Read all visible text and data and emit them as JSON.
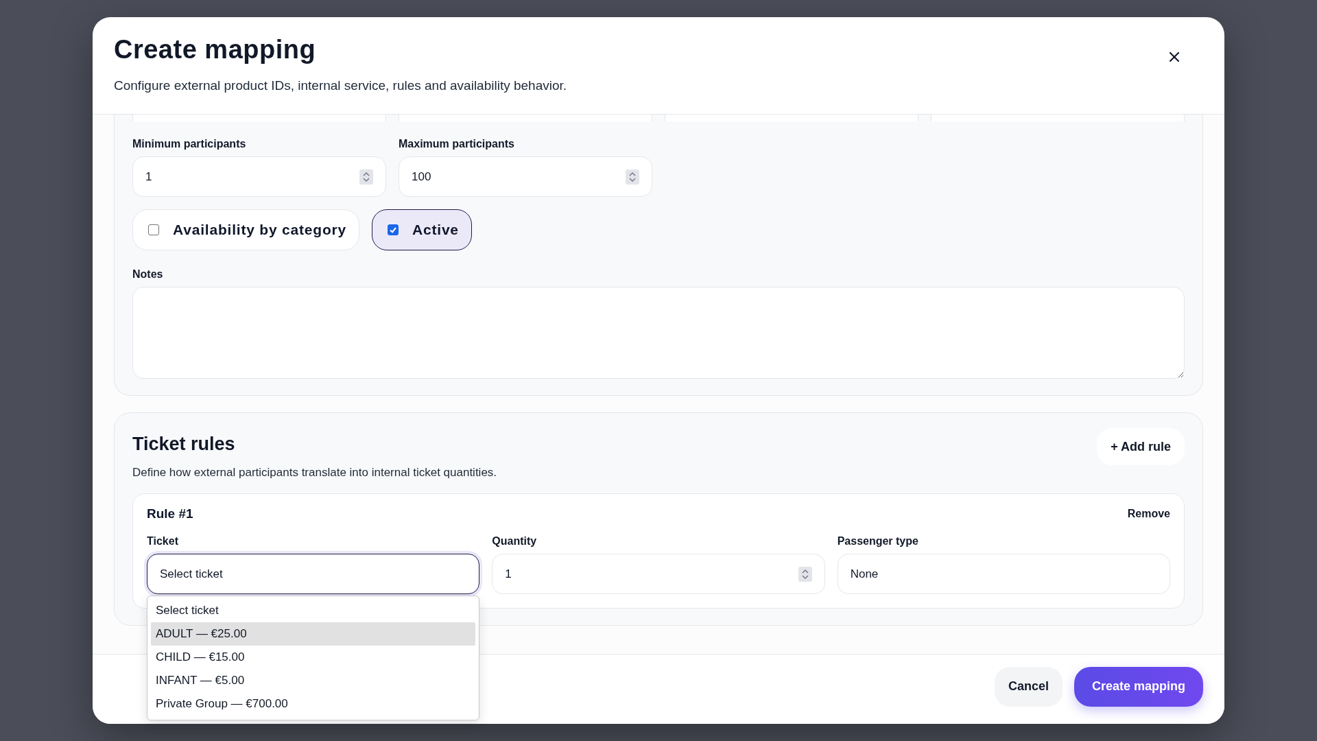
{
  "dialog": {
    "title": "Create mapping",
    "subtitle": "Configure external product IDs, internal service, rules and availability behavior."
  },
  "participants": [
    {
      "label": "Minimum participants",
      "value": "1"
    },
    {
      "label": "Maximum participants",
      "value": "100"
    }
  ],
  "toggles": [
    {
      "label": "Availability by category",
      "checked": false
    },
    {
      "label": "Active",
      "checked": true
    }
  ],
  "notes": {
    "label": "Notes"
  },
  "ticket_rules": {
    "title": "Ticket rules",
    "description": "Define how external participants translate into internal ticket quantities.",
    "add_button": "+ Add rule",
    "rules": [
      {
        "title": "Rule #1",
        "remove": "Remove",
        "fields": [
          {
            "kind": "select",
            "label": "Ticket",
            "value": "Select ticket",
            "expanded": true,
            "options": [
              {
                "label": "Select ticket",
                "highlighted": false
              },
              {
                "label": "ADULT — €25.00",
                "highlighted": true
              },
              {
                "label": "CHILD — €15.00",
                "highlighted": false
              },
              {
                "label": "INFANT — €5.00",
                "highlighted": false
              },
              {
                "label": "Private Group — €700.00",
                "highlighted": false
              }
            ]
          },
          {
            "kind": "number",
            "label": "Quantity",
            "value": "1"
          },
          {
            "kind": "text",
            "label": "Passenger type",
            "value": "None"
          }
        ]
      }
    ]
  },
  "footer": {
    "cancel": "Cancel",
    "submit": "Create mapping"
  }
}
